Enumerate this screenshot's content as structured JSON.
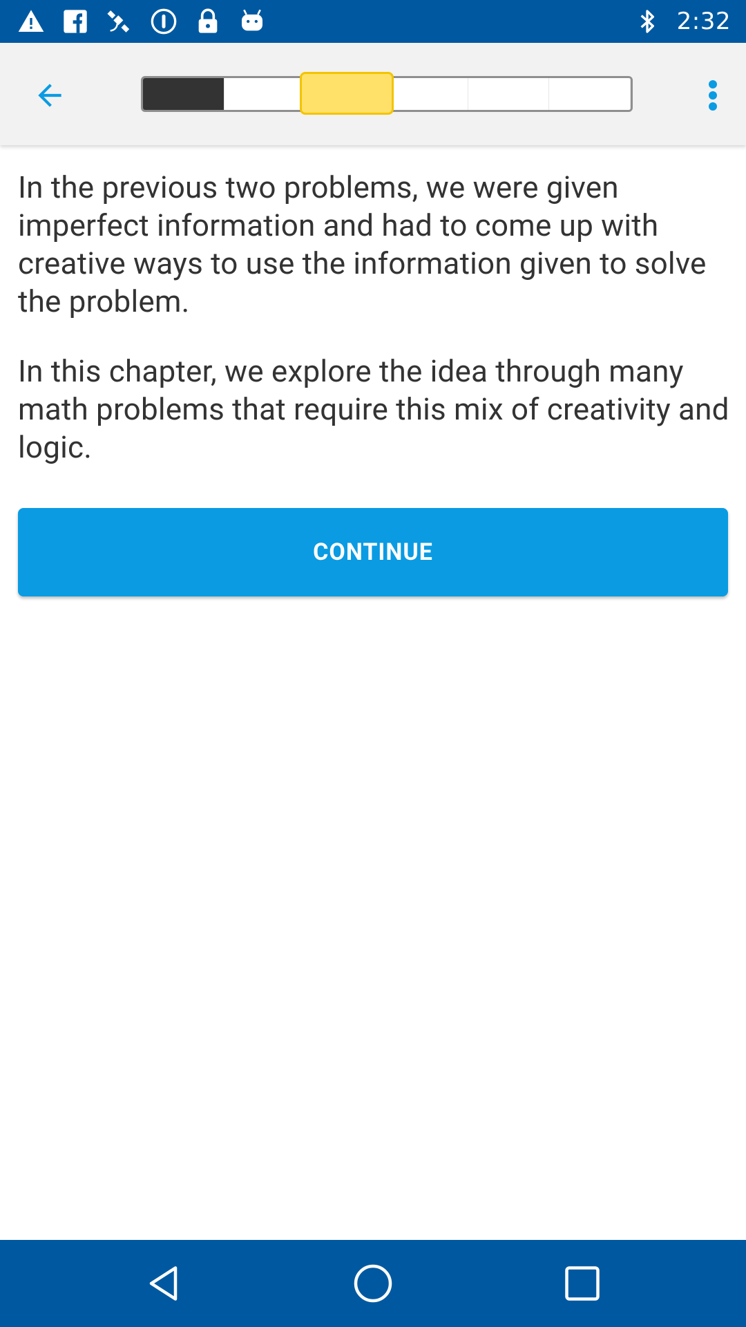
{
  "status_bar": {
    "time": "2:32",
    "left_icons": [
      "warning-icon",
      "facebook-icon",
      "satellite-icon",
      "info-circle-icon",
      "lock-icon",
      "android-icon"
    ],
    "right_icons": [
      "bluetooth-icon"
    ]
  },
  "app_bar": {
    "back_icon": "arrow-back-icon",
    "more_icon": "more-vert-icon",
    "progress": {
      "segments_total": 6,
      "segments_completed": 1,
      "current_segment": 2,
      "colors": {
        "done": "#333333",
        "current": "#ffe16a",
        "current_border": "#f3c400",
        "empty": "#ffffff"
      }
    }
  },
  "content": {
    "paragraphs": [
      "In the previous two problems, we were given imperfect information and had to come up with creative ways to use the information given to solve the problem.",
      "In this chapter, we explore the idea through many math problems that require this mix of creativity and logic."
    ],
    "continue_label": "CONTINUE"
  },
  "nav_bar": {
    "buttons": [
      "back-triangle-icon",
      "home-circle-icon",
      "recents-square-icon"
    ]
  },
  "colors": {
    "status_bar": "#0059a0",
    "accent": "#0a9be3",
    "text": "#333333",
    "app_bar_bg": "#f2f2f2"
  }
}
